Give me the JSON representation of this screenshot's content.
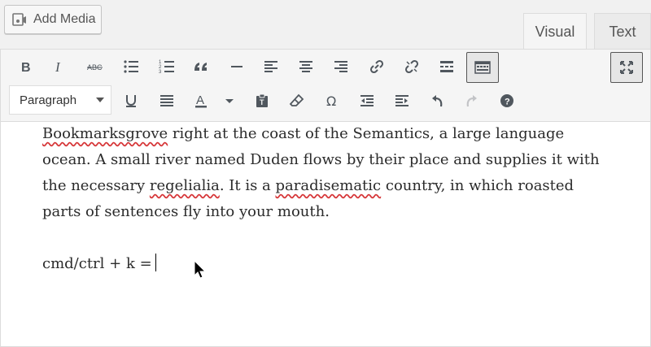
{
  "add_media": {
    "label": "Add Media",
    "icon": "media-icon"
  },
  "tabs": [
    {
      "label": "Visual",
      "active": true
    },
    {
      "label": "Text",
      "active": false
    }
  ],
  "toolbar": {
    "row1": [
      "bold",
      "italic",
      "strikethrough",
      "bullet-list",
      "numbered-list",
      "blockquote",
      "horizontal-line",
      "align-left",
      "align-center",
      "align-right",
      "insert-link",
      "remove-link",
      "read-more",
      "toolbar-toggle"
    ],
    "row2": [
      "underline",
      "justify",
      "text-color",
      "text-color-dropdown",
      "paste-as-text",
      "clear-formatting",
      "special-character",
      "outdent",
      "indent",
      "undo",
      "redo",
      "help"
    ],
    "format_select": {
      "value": "Paragraph"
    }
  },
  "content": {
    "paragraph1": {
      "part_a": "Bookmarksgrove",
      "part_b": " right at the coast of the Semantics, a large language ocean. A small river named Duden flows by their place and supplies it with the necessary ",
      "part_c": "regelialia",
      "part_d": ". It is a ",
      "part_e": "paradisematic",
      "part_f": " country, in which roasted parts of sentences fly into your mouth."
    },
    "paragraph2": "cmd/ctrl + k ="
  },
  "colors": {
    "spellcheck": "#d63638",
    "toolbar_bg": "#f5f5f5"
  }
}
